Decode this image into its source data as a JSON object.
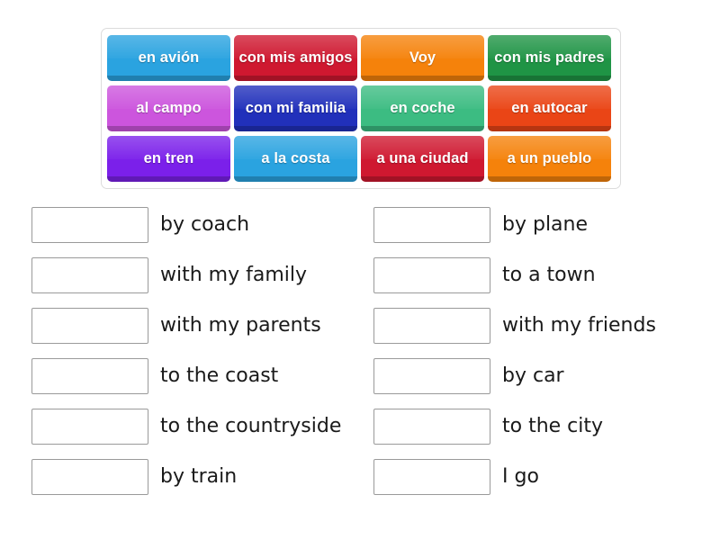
{
  "activity": {
    "type": "match-up",
    "tile_bank": {
      "rows": [
        [
          {
            "label": "en avión",
            "color": "#2aa3e0"
          },
          {
            "label": "con mis amigos",
            "color": "#cf1830"
          },
          {
            "label": "Voy",
            "color": "#f5820b"
          },
          {
            "label": "con mis padres",
            "color": "#1f9445"
          }
        ],
        [
          {
            "label": "al campo",
            "color": "#cc55dd"
          },
          {
            "label": "con mi familia",
            "color": "#2130bb"
          },
          {
            "label": "en coche",
            "color": "#3cbc82"
          },
          {
            "label": "en autocar",
            "color": "#ea4516"
          }
        ],
        [
          {
            "label": "en tren",
            "color": "#7b20ea"
          },
          {
            "label": "a la costa",
            "color": "#2aa3e0"
          },
          {
            "label": "a una ciudad",
            "color": "#cf1830"
          },
          {
            "label": "a un pueblo",
            "color": "#f5820b"
          }
        ]
      ]
    },
    "answers": {
      "left_column": [
        {
          "value": "",
          "placeholder": "",
          "label": "by coach"
        },
        {
          "value": "",
          "placeholder": "",
          "label": "with my family"
        },
        {
          "value": "",
          "placeholder": "",
          "label": "with my parents"
        },
        {
          "value": "",
          "placeholder": "",
          "label": "to the coast"
        },
        {
          "value": "",
          "placeholder": "",
          "label": "to the countryside"
        },
        {
          "value": "",
          "placeholder": "",
          "label": "by train"
        }
      ],
      "right_column": [
        {
          "value": "",
          "placeholder": "",
          "label": "by plane"
        },
        {
          "value": "",
          "placeholder": "",
          "label": "to a town"
        },
        {
          "value": "",
          "placeholder": "",
          "label": "with my friends"
        },
        {
          "value": "",
          "placeholder": "",
          "label": "by car"
        },
        {
          "value": "",
          "placeholder": "",
          "label": "to the city"
        },
        {
          "value": "",
          "placeholder": "",
          "label": "I go"
        }
      ]
    }
  }
}
